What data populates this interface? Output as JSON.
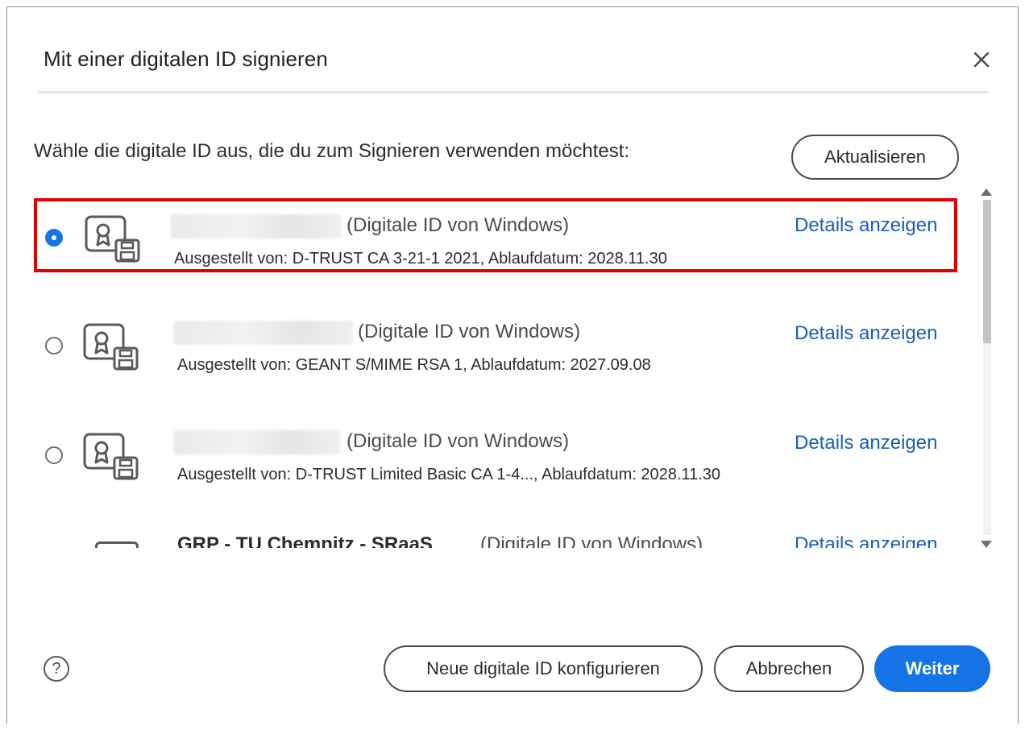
{
  "dialog": {
    "title": "Mit einer digitalen ID signieren",
    "close_icon": "close-icon",
    "prompt": "Wähle die digitale ID aus, die du zum Signieren verwenden möchtest:",
    "refresh_label": "Aktualisieren"
  },
  "ids": [
    {
      "selected": true,
      "kind": "(Digitale ID von Windows)",
      "issuer": "Ausgestellt von: D-TRUST CA 3-21-1 2021, Ablaufdatum: 2028.11.30",
      "details": "Details anzeigen",
      "icon": "certificate-icon"
    },
    {
      "selected": false,
      "kind": "(Digitale ID von Windows)",
      "issuer": "Ausgestellt von: GEANT S/MIME RSA 1, Ablaufdatum: 2027.09.08",
      "details": "Details anzeigen",
      "icon": "certificate-icon"
    },
    {
      "selected": false,
      "kind": "(Digitale ID von Windows)",
      "issuer": "Ausgestellt von: D-TRUST Limited Basic CA 1-4..., Ablaufdatum: 2028.11.30",
      "details": "Details anzeigen",
      "icon": "certificate-icon"
    },
    {
      "selected": false,
      "name": "GRP - TU Chemnitz - SRaaS",
      "kind": "(Digitale ID von Windows)",
      "details": "Details anzeigen",
      "partially_visible": true
    }
  ],
  "footer": {
    "help_icon": "help-icon",
    "new_id_label": "Neue digitale ID konfigurieren",
    "cancel_label": "Abbrechen",
    "next_label": "Weiter"
  },
  "colors": {
    "accent": "#1473e6",
    "link": "#1a5eb8",
    "selection_highlight": "#e00000"
  }
}
